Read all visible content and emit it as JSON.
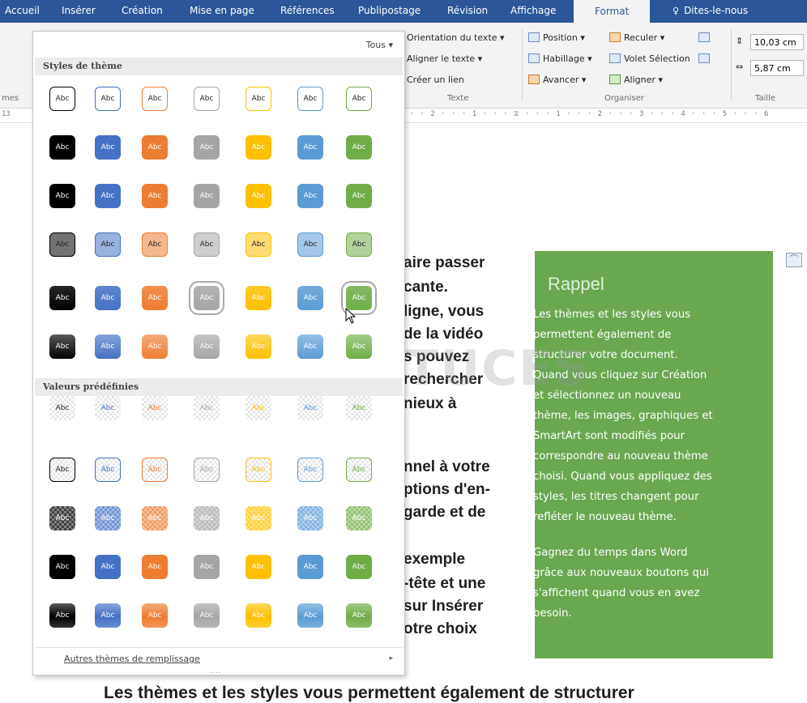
{
  "ribbon": {
    "tabs": [
      {
        "label": "Accueil"
      },
      {
        "label": "Insérer"
      },
      {
        "label": "Création"
      },
      {
        "label": "Mise en page"
      },
      {
        "label": "Références"
      },
      {
        "label": "Publipostage"
      },
      {
        "label": "Révision"
      },
      {
        "label": "Affichage"
      },
      {
        "label": "Format"
      },
      {
        "label": "Dites-le-nous"
      }
    ],
    "texte_group": {
      "items": [
        "Orientation du texte ▾",
        "Aligner le texte ▾",
        "Créer un lien"
      ],
      "label": "Texte"
    },
    "organiser_group": {
      "position": "Position ▾",
      "habillage": "Habillage ▾",
      "avancer": "Avancer ▾",
      "reculer": "Reculer ▾",
      "volet": "Volet Sélection",
      "aligner": "Aligner ▾",
      "label": "Organiser"
    },
    "taille_group": {
      "height_value": "10,03 cm",
      "width_value": "5,87 cm",
      "label": "Taille"
    },
    "left_group_label": "mes"
  },
  "ruler": {
    "left": "13",
    "marks": "3 · · · 2 · · · 1 · · · ⧖ · · · 1 · · · 2 · · · 3 · · · 4 · · · 5 · · · 6"
  },
  "gallery": {
    "filter_label": "Tous ▾",
    "section_theme": "Styles de thème",
    "section_presets": "Valeurs prédéfinies",
    "swatch_label": "Abc",
    "footer_link": "Autres thèmes de remplissage",
    "footer_arrow": "▸",
    "grip": "....",
    "colors": [
      "#000000",
      "#4472c4",
      "#ed7d31",
      "#a5a5a5",
      "#ffc000",
      "#5b9bd5",
      "#70ad47"
    ]
  },
  "document": {
    "lines": [
      "aire passer",
      "cante.",
      "ligne, vous",
      "de la vidéo",
      "s pouvez",
      "rechercher",
      "nieux à",
      "nnel à votre",
      "ptions d'en-",
      "garde et de",
      "exemple",
      "-tête et une",
      "sur Insérer",
      "otre choix"
    ],
    "bottom_line": "Les thèmes et les styles vous permettent également de structurer"
  },
  "sidebar": {
    "title": "Rappel",
    "paragraph1": [
      "Les thèmes et les styles vous",
      "permettent également de",
      "structurer votre document.",
      "Quand vous cliquez sur Création",
      "et sélectionnez un nouveau",
      "thème, les images, graphiques et",
      "SmartArt sont modifiés pour",
      "correspondre au nouveau thème",
      "choisi. Quand vous appliquez des",
      "styles, les titres changent pour",
      "refléter le nouveau thème."
    ],
    "paragraph2": [
      "Gagnez du temps dans Word",
      "grâce aux nouveaux boutons qui",
      "s'affichent quand vous en avez",
      "besoin."
    ],
    "color": "#6aa84f"
  },
  "watermark": "PC ASTUCES"
}
